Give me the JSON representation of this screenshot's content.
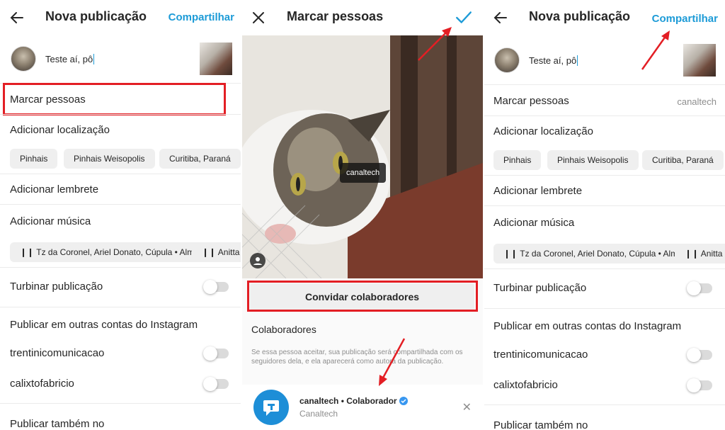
{
  "colors": {
    "accent": "#1d9bd7",
    "highlight": "#e31e24",
    "verified": "#3897f0"
  },
  "panel1": {
    "header": {
      "title": "Nova publicação",
      "share": "Compartilhar",
      "back_icon": "back-arrow-icon"
    },
    "caption": {
      "text": "Teste aí, pô"
    },
    "rows": {
      "tag_people": "Marcar pessoas",
      "add_location": "Adicionar localização",
      "add_reminder": "Adicionar lembrete",
      "add_music": "Adicionar música",
      "boost": "Turbinar publicação",
      "publish_other": "Publicar em outras contas do Instagram",
      "account1": "trentinicomunicacao",
      "account2": "calixtofabricio",
      "publish_also": "Publicar também no"
    },
    "location_chips": [
      "Pinhais",
      "Pinhais Weisopolis",
      "Curitiba, Paraná"
    ],
    "music_chips": [
      "Tz da Coronel, Ariel Donato, Cúpula • Alma",
      "Anitta"
    ]
  },
  "panel2": {
    "header": {
      "title": "Marcar pessoas",
      "close_icon": "close-icon",
      "confirm_icon": "check-icon"
    },
    "tag_label": "canaltech",
    "invite_button": "Convidar colaboradores",
    "collaborators_heading": "Colaboradores",
    "collaborators_note": "Se essa pessoa aceitar, sua publicação será compartilhada com os seguidores dela, e ela aparecerá como autora da publicação.",
    "collaborator": {
      "name": "canaltech • Colaborador",
      "subtitle": "Canaltech"
    }
  },
  "panel3": {
    "header": {
      "title": "Nova publicação",
      "share": "Compartilhar"
    },
    "caption": {
      "text": "Teste aí, pô"
    },
    "rows": {
      "tag_people": "Marcar pessoas",
      "tag_people_value": "canaltech",
      "add_location": "Adicionar localização",
      "add_reminder": "Adicionar lembrete",
      "add_music": "Adicionar música",
      "boost": "Turbinar publicação",
      "publish_other": "Publicar em outras contas do Instagram",
      "account1": "trentinicomunicacao",
      "account2": "calixtofabricio",
      "publish_also": "Publicar também no"
    },
    "location_chips": [
      "Pinhais",
      "Pinhais Weisopolis",
      "Curitiba, Paraná"
    ],
    "music_chips": [
      "Tz da Coronel, Ariel Donato, Cúpula • Alma",
      "Anitta"
    ]
  }
}
